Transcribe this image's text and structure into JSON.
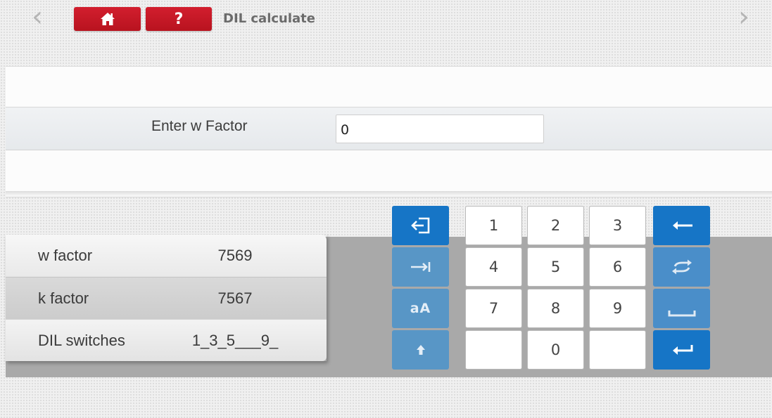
{
  "header": {
    "title": "DIL calculate",
    "help_label": "?",
    "back_glyph": "‹",
    "forward_glyph": "›",
    "home_icon": "home-icon",
    "accent_color": "#c8192a"
  },
  "form": {
    "label": "Enter w Factor",
    "input_value": "0"
  },
  "results": {
    "rows": [
      {
        "label": "w factor",
        "value": "7569"
      },
      {
        "label": "k factor",
        "value": "7567"
      },
      {
        "label": "DIL switches",
        "value": "1_3_5___9_"
      }
    ]
  },
  "keypad": {
    "digits": [
      "1",
      "2",
      "3",
      "4",
      "5",
      "6",
      "7",
      "8",
      "9",
      "0"
    ],
    "case_toggle": "aA",
    "icons": {
      "exit": "exit-icon",
      "tab": "tab-icon",
      "shift": "shift-arrow-icon",
      "backspace": "backspace-icon",
      "swap": "swap-icon",
      "space": "space-icon",
      "enter": "enter-icon"
    },
    "colors": {
      "primary": "#1675c6",
      "dimmed": "#5896c6"
    }
  }
}
